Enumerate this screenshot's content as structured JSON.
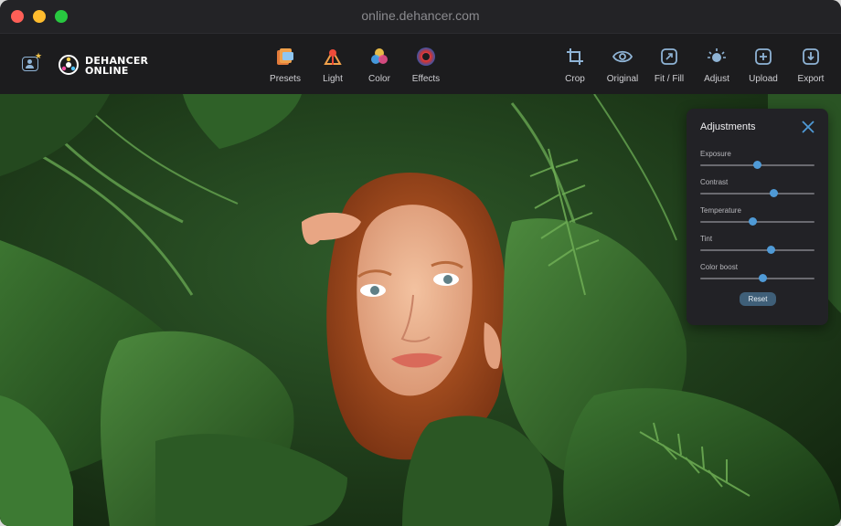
{
  "window": {
    "url": "online.dehancer.com"
  },
  "brand": {
    "line1": "DEHANCER",
    "line2": "ONLINE"
  },
  "toolbar": {
    "center_tools": [
      {
        "label": "Presets",
        "icon": "presets-icon"
      },
      {
        "label": "Light",
        "icon": "light-icon"
      },
      {
        "label": "Color",
        "icon": "color-icon"
      },
      {
        "label": "Effects",
        "icon": "effects-icon"
      }
    ],
    "right_tools": [
      {
        "label": "Crop",
        "icon": "crop-icon"
      },
      {
        "label": "Original",
        "icon": "eye-icon"
      },
      {
        "label": "Fit / Fill",
        "icon": "fit-fill-icon"
      },
      {
        "label": "Adjust",
        "icon": "adjust-icon"
      },
      {
        "label": "Upload",
        "icon": "upload-icon"
      },
      {
        "label": "Export",
        "icon": "export-icon"
      }
    ]
  },
  "adjustments": {
    "title": "Adjustments",
    "sliders": [
      {
        "label": "Exposure",
        "value": 0.5
      },
      {
        "label": "Contrast",
        "value": 0.64
      },
      {
        "label": "Temperature",
        "value": 0.46
      },
      {
        "label": "Tint",
        "value": 0.62
      },
      {
        "label": "Color boost",
        "value": 0.55
      }
    ],
    "reset_label": "Reset"
  },
  "colors": {
    "accent": "#4f9ad6",
    "reset_button": "#3f5f78",
    "traffic_red": "#fe5f57",
    "traffic_yellow": "#febc2e",
    "traffic_green": "#28c840"
  }
}
